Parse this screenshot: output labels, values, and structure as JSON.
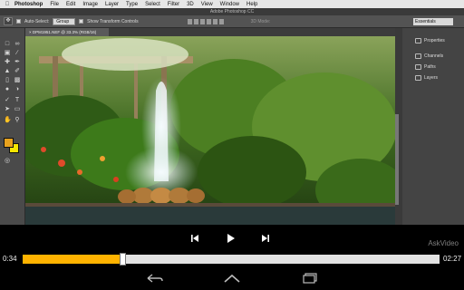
{
  "menubar": {
    "items": [
      "Photoshop",
      "File",
      "Edit",
      "Image",
      "Layer",
      "Type",
      "Select",
      "Filter",
      "3D",
      "View",
      "Window",
      "Help"
    ]
  },
  "window": {
    "title": "Adobe Photoshop CC"
  },
  "options": {
    "auto_select_label": "Auto-Select:",
    "auto_select_value": "Group",
    "show_transform_label": "Show Transform Controls",
    "mode_label": "3D Mode:",
    "workspace": "Essentials"
  },
  "document": {
    "tab_label": "DPM1951.NEF @ 33.3% (RGB/16)"
  },
  "panels": {
    "items": [
      "Properties",
      "Channels",
      "Paths",
      "Layers"
    ]
  },
  "player": {
    "elapsed": "0:34",
    "total": "02:27",
    "progress": 0.24,
    "watermark": "AskVideo"
  },
  "colors": {
    "accent": "#ffb300",
    "foreground_swatch": "#e8a21e",
    "background_swatch": "#f5e600"
  },
  "icons": {
    "player": [
      "skip-back-icon",
      "play-icon",
      "skip-forward-icon"
    ],
    "nav": [
      "back-icon",
      "home-icon",
      "recent-apps-icon"
    ]
  }
}
